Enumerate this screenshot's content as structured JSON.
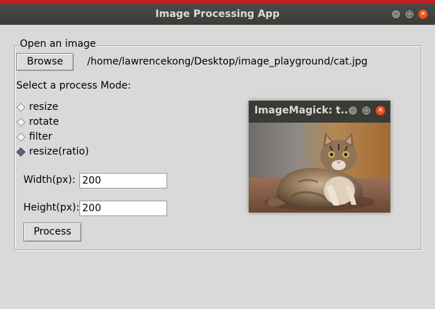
{
  "window": {
    "title": "Image Processing App"
  },
  "open_frame": {
    "legend": "Open an image",
    "browse_label": "Browse",
    "path": "/home/lawrencekong/Desktop/image_playground/cat.jpg"
  },
  "mode": {
    "prompt": "Select a process Mode:",
    "options": [
      "resize",
      "rotate",
      "filter",
      "resize(ratio)"
    ],
    "selected": "resize(ratio)"
  },
  "width_field": {
    "label": "Width(px):",
    "value": "200"
  },
  "height_field": {
    "label": "Height(px):",
    "value": "200"
  },
  "process_label": "Process",
  "preview": {
    "title": "ImageMagick: t..."
  },
  "colors": {
    "titlebar": "#3c3c38",
    "close": "#e95420",
    "accent_top": "#c51d23",
    "background": "#d9d9d9"
  }
}
